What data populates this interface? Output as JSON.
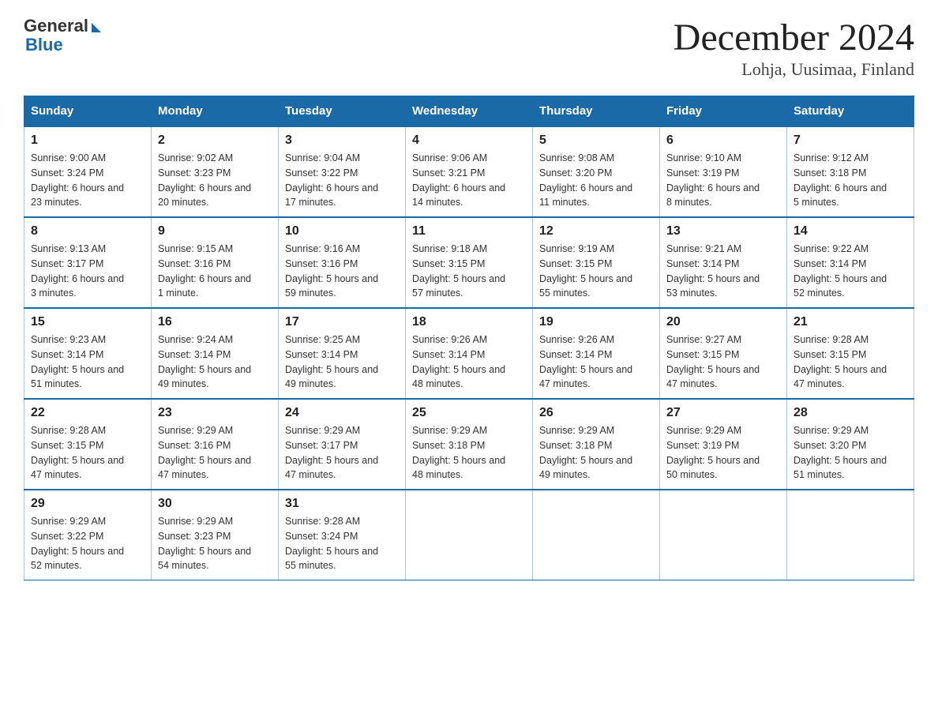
{
  "logo": {
    "general": "General",
    "blue": "Blue"
  },
  "title": "December 2024",
  "subtitle": "Lohja, Uusimaa, Finland",
  "days_of_week": [
    "Sunday",
    "Monday",
    "Tuesday",
    "Wednesday",
    "Thursday",
    "Friday",
    "Saturday"
  ],
  "weeks": [
    [
      {
        "day": "1",
        "sunrise": "9:00 AM",
        "sunset": "3:24 PM",
        "daylight": "6 hours and 23 minutes."
      },
      {
        "day": "2",
        "sunrise": "9:02 AM",
        "sunset": "3:23 PM",
        "daylight": "6 hours and 20 minutes."
      },
      {
        "day": "3",
        "sunrise": "9:04 AM",
        "sunset": "3:22 PM",
        "daylight": "6 hours and 17 minutes."
      },
      {
        "day": "4",
        "sunrise": "9:06 AM",
        "sunset": "3:21 PM",
        "daylight": "6 hours and 14 minutes."
      },
      {
        "day": "5",
        "sunrise": "9:08 AM",
        "sunset": "3:20 PM",
        "daylight": "6 hours and 11 minutes."
      },
      {
        "day": "6",
        "sunrise": "9:10 AM",
        "sunset": "3:19 PM",
        "daylight": "6 hours and 8 minutes."
      },
      {
        "day": "7",
        "sunrise": "9:12 AM",
        "sunset": "3:18 PM",
        "daylight": "6 hours and 5 minutes."
      }
    ],
    [
      {
        "day": "8",
        "sunrise": "9:13 AM",
        "sunset": "3:17 PM",
        "daylight": "6 hours and 3 minutes."
      },
      {
        "day": "9",
        "sunrise": "9:15 AM",
        "sunset": "3:16 PM",
        "daylight": "6 hours and 1 minute."
      },
      {
        "day": "10",
        "sunrise": "9:16 AM",
        "sunset": "3:16 PM",
        "daylight": "5 hours and 59 minutes."
      },
      {
        "day": "11",
        "sunrise": "9:18 AM",
        "sunset": "3:15 PM",
        "daylight": "5 hours and 57 minutes."
      },
      {
        "day": "12",
        "sunrise": "9:19 AM",
        "sunset": "3:15 PM",
        "daylight": "5 hours and 55 minutes."
      },
      {
        "day": "13",
        "sunrise": "9:21 AM",
        "sunset": "3:14 PM",
        "daylight": "5 hours and 53 minutes."
      },
      {
        "day": "14",
        "sunrise": "9:22 AM",
        "sunset": "3:14 PM",
        "daylight": "5 hours and 52 minutes."
      }
    ],
    [
      {
        "day": "15",
        "sunrise": "9:23 AM",
        "sunset": "3:14 PM",
        "daylight": "5 hours and 51 minutes."
      },
      {
        "day": "16",
        "sunrise": "9:24 AM",
        "sunset": "3:14 PM",
        "daylight": "5 hours and 49 minutes."
      },
      {
        "day": "17",
        "sunrise": "9:25 AM",
        "sunset": "3:14 PM",
        "daylight": "5 hours and 49 minutes."
      },
      {
        "day": "18",
        "sunrise": "9:26 AM",
        "sunset": "3:14 PM",
        "daylight": "5 hours and 48 minutes."
      },
      {
        "day": "19",
        "sunrise": "9:26 AM",
        "sunset": "3:14 PM",
        "daylight": "5 hours and 47 minutes."
      },
      {
        "day": "20",
        "sunrise": "9:27 AM",
        "sunset": "3:15 PM",
        "daylight": "5 hours and 47 minutes."
      },
      {
        "day": "21",
        "sunrise": "9:28 AM",
        "sunset": "3:15 PM",
        "daylight": "5 hours and 47 minutes."
      }
    ],
    [
      {
        "day": "22",
        "sunrise": "9:28 AM",
        "sunset": "3:15 PM",
        "daylight": "5 hours and 47 minutes."
      },
      {
        "day": "23",
        "sunrise": "9:29 AM",
        "sunset": "3:16 PM",
        "daylight": "5 hours and 47 minutes."
      },
      {
        "day": "24",
        "sunrise": "9:29 AM",
        "sunset": "3:17 PM",
        "daylight": "5 hours and 47 minutes."
      },
      {
        "day": "25",
        "sunrise": "9:29 AM",
        "sunset": "3:18 PM",
        "daylight": "5 hours and 48 minutes."
      },
      {
        "day": "26",
        "sunrise": "9:29 AM",
        "sunset": "3:18 PM",
        "daylight": "5 hours and 49 minutes."
      },
      {
        "day": "27",
        "sunrise": "9:29 AM",
        "sunset": "3:19 PM",
        "daylight": "5 hours and 50 minutes."
      },
      {
        "day": "28",
        "sunrise": "9:29 AM",
        "sunset": "3:20 PM",
        "daylight": "5 hours and 51 minutes."
      }
    ],
    [
      {
        "day": "29",
        "sunrise": "9:29 AM",
        "sunset": "3:22 PM",
        "daylight": "5 hours and 52 minutes."
      },
      {
        "day": "30",
        "sunrise": "9:29 AM",
        "sunset": "3:23 PM",
        "daylight": "5 hours and 54 minutes."
      },
      {
        "day": "31",
        "sunrise": "9:28 AM",
        "sunset": "3:24 PM",
        "daylight": "5 hours and 55 minutes."
      },
      null,
      null,
      null,
      null
    ]
  ],
  "labels": {
    "sunrise": "Sunrise:",
    "sunset": "Sunset:",
    "daylight": "Daylight:"
  }
}
